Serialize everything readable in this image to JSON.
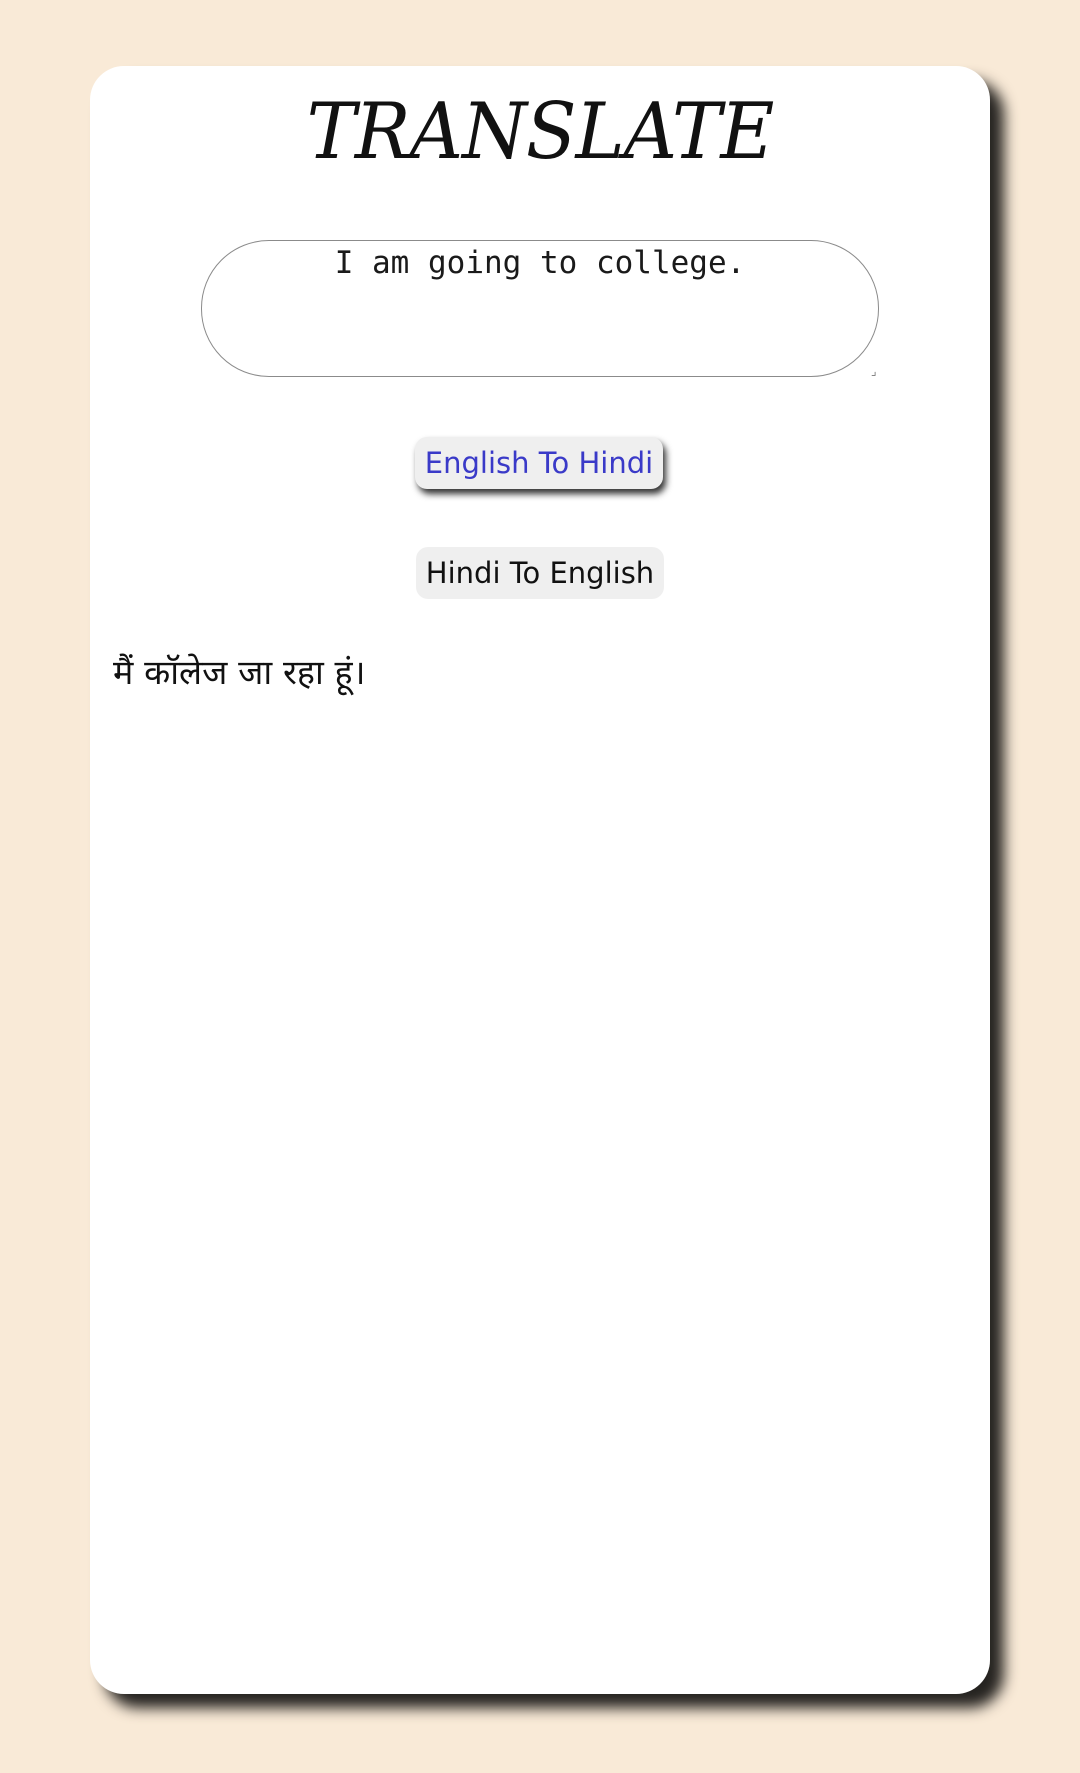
{
  "app": {
    "title": "TRANSLATE"
  },
  "input": {
    "value": "I am going to college."
  },
  "buttons": {
    "english_to_hindi": "English To Hindi",
    "hindi_to_english": "Hindi To English"
  },
  "output": {
    "text": "मैं कॉलेज जा रहा हूं।"
  },
  "colors": {
    "page_background": "#f9ead7",
    "card_background": "#ffffff",
    "active_button_text": "#3a3ac8",
    "button_background": "#efefef"
  }
}
